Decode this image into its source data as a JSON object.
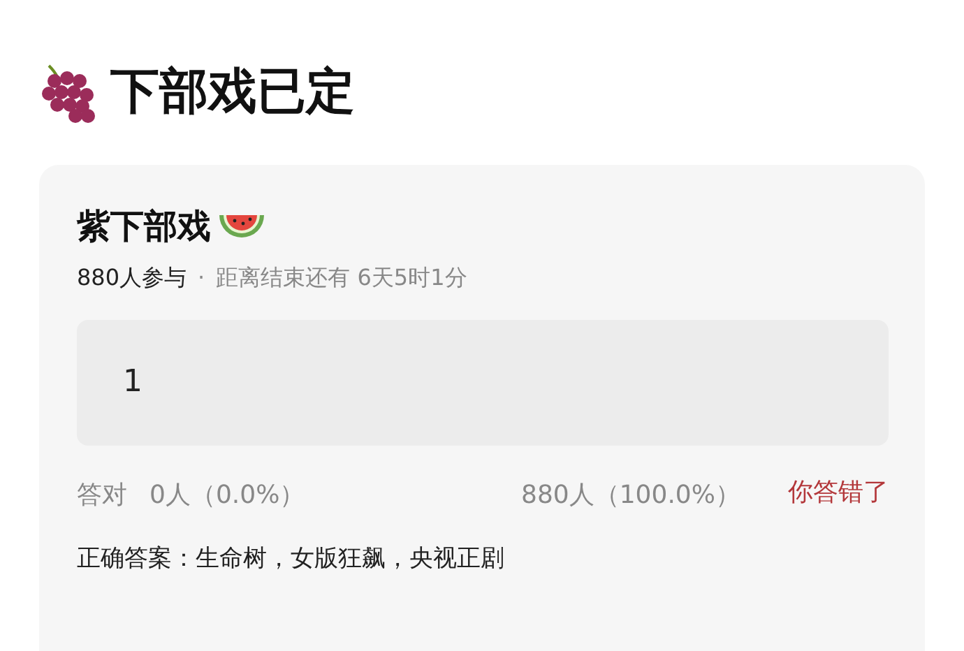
{
  "page_title": "下部戏已定",
  "poll": {
    "title": "紫下部戏",
    "participants": "880人参与",
    "separator": "·",
    "countdown": "距离结束还有 6天5时1分",
    "answer": "1",
    "correct_label": "答对",
    "correct_count": "0人（0.0%）",
    "wrong_count": "880人（100.0%）",
    "result": "你答错了",
    "correct_answer": "正确答案：生命树，女版狂飙，央视正剧"
  }
}
